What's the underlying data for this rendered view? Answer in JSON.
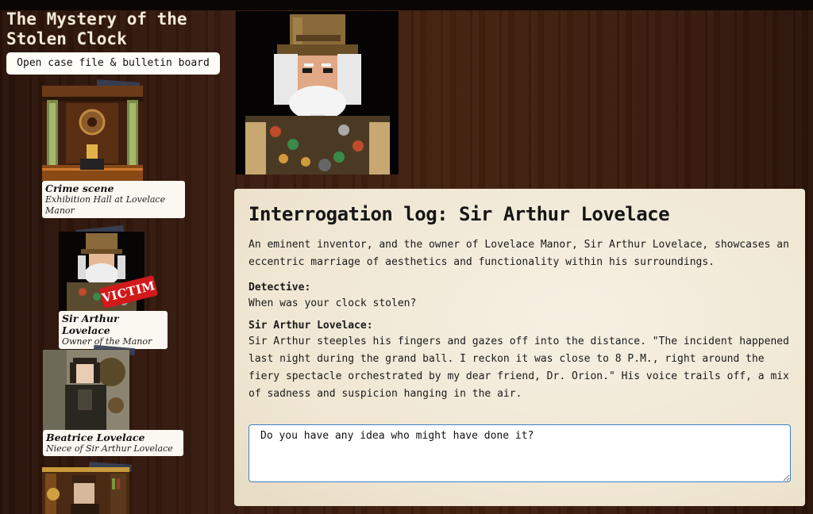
{
  "game": {
    "title": "The Mystery of the Stolen Clock",
    "open_case_button": "Open case file & bulletin board"
  },
  "sidebar": {
    "cards": [
      {
        "name": "Crime scene",
        "role": "Exhibition Hall at Lovelace Manor"
      },
      {
        "name": "Sir Arthur Lovelace",
        "role": "Owner of the Manor",
        "badge": "VICTIM"
      },
      {
        "name": "Beatrice Lovelace",
        "role": "Niece of Sir Arthur Lovelace"
      }
    ]
  },
  "log": {
    "title": "Interrogation log: Sir Arthur Lovelace",
    "intro": "An eminent inventor, and the owner of Lovelace Manor, Sir Arthur Lovelace, showcases an eccentric marriage of aesthetics and functionality within his surroundings.",
    "entries": [
      {
        "speaker": "Detective:",
        "text": "When was your clock stolen?"
      },
      {
        "speaker": "Sir Arthur Lovelace:",
        "text": "Sir Arthur steeples his fingers and gazes off into the distance. \"The incident happened last night during the grand ball. I reckon it was close to 8 P.M., right around the fiery spectacle orchestrated by my dear friend, Dr. Orion.\" His voice trails off, a mix of sadness and suspicion hanging in the air."
      }
    ],
    "input_value": "Do you have any idea who might have done it?"
  },
  "colors": {
    "background_wood": "#3a1d10",
    "panel_parchment": "#f6f0e2",
    "victim_badge": "#d21a1a",
    "input_focus_border": "#3f7fc4",
    "tape": "#364155"
  }
}
